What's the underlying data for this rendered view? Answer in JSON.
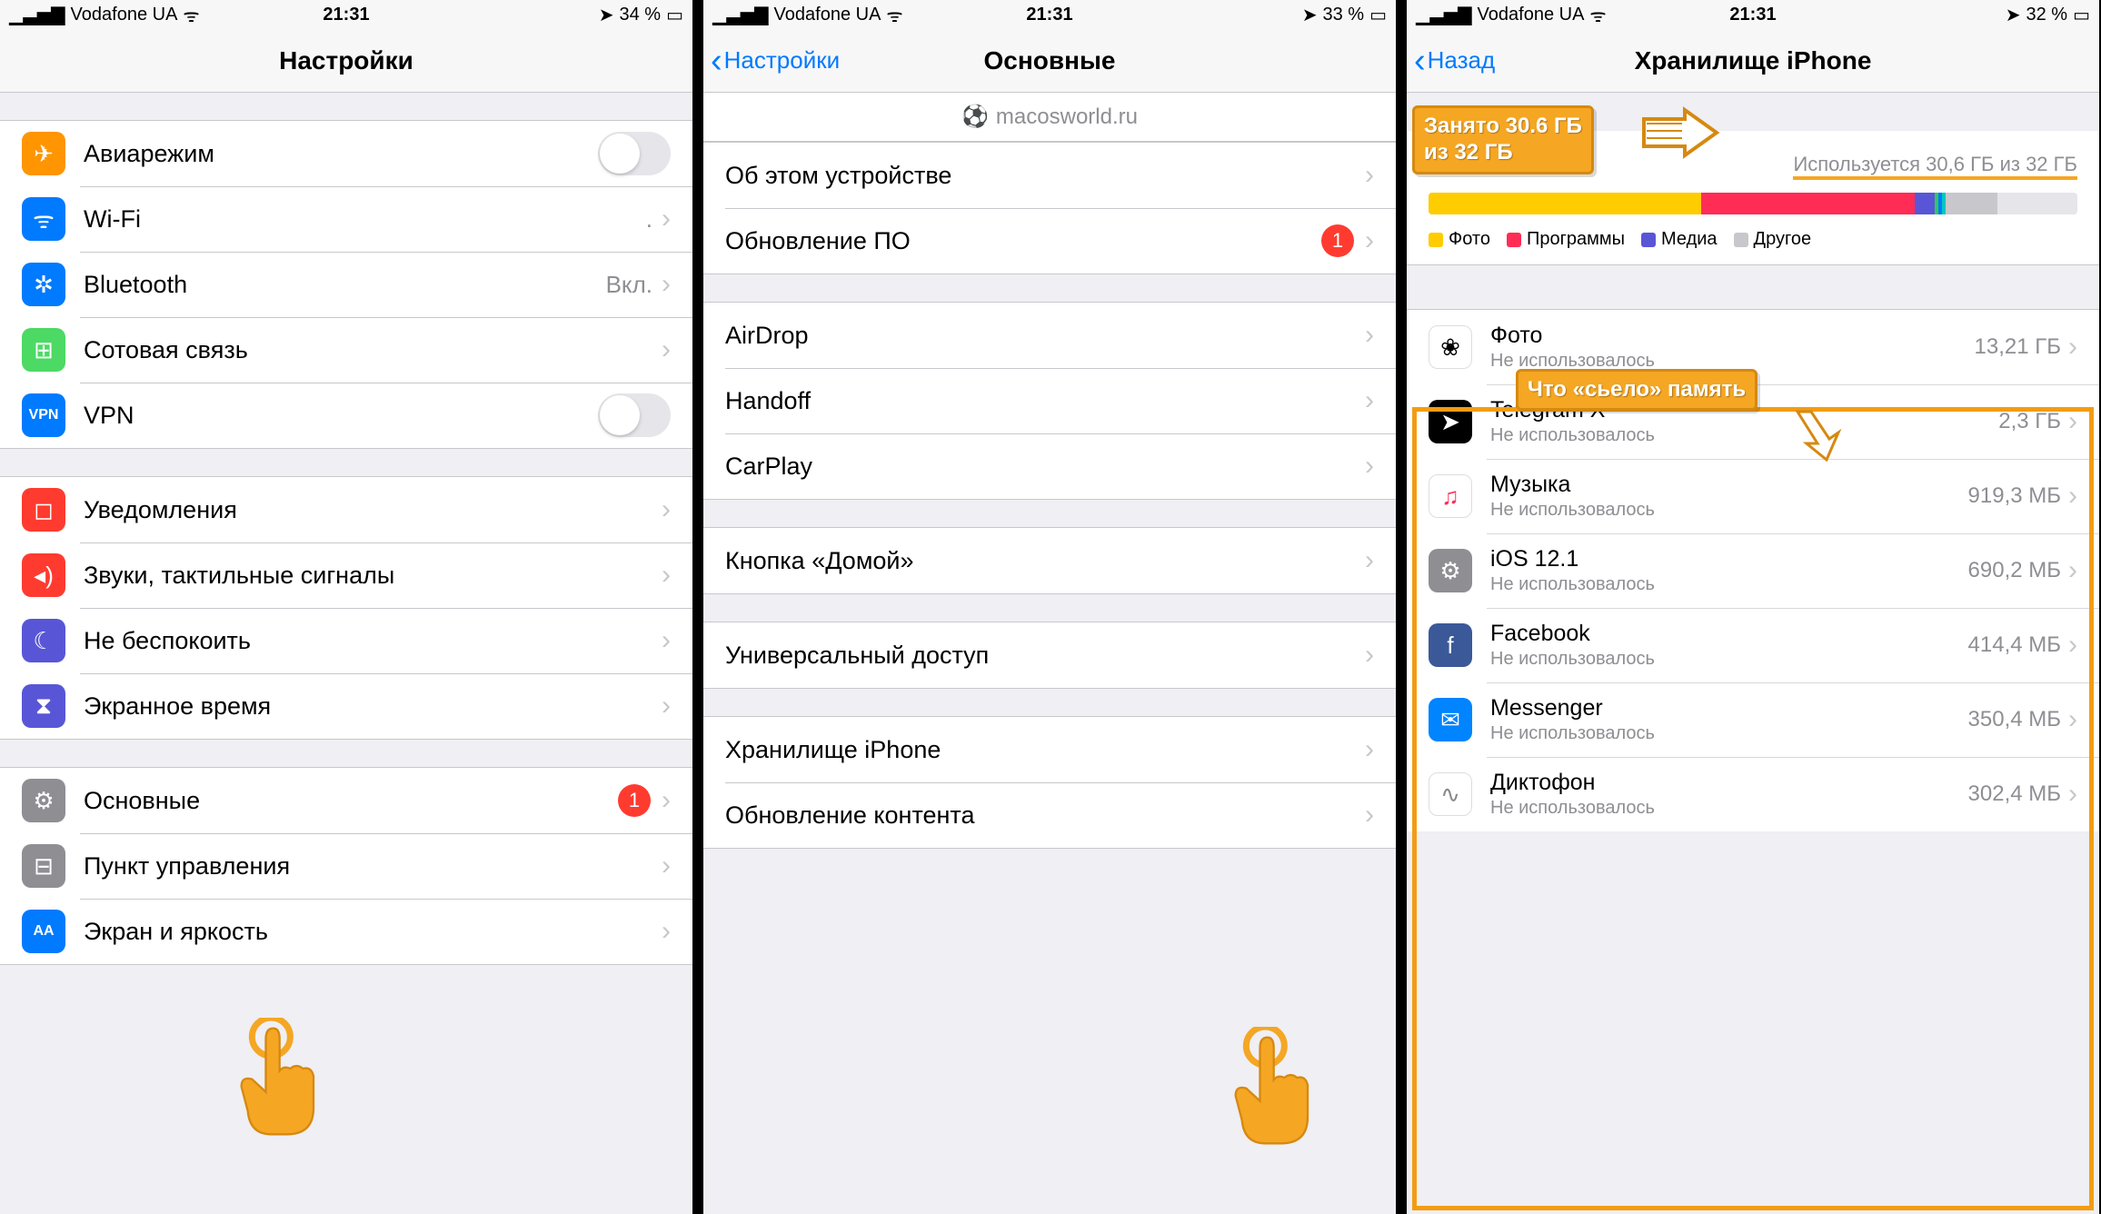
{
  "status_bar": {
    "carrier": "Vodafone UA",
    "time": "21:31",
    "location_icon": "➤",
    "battery1": "34 %",
    "battery2": "33 %",
    "battery3": "32 %"
  },
  "panel1": {
    "title": "Настройки",
    "rows_g1": [
      {
        "icon_bg": "#ff9500",
        "icon": "✈",
        "label": "Авиарежим",
        "type": "toggle"
      },
      {
        "icon_bg": "#007aff",
        "icon": "ᯤ",
        "label": "Wi-Fi",
        "value": ".",
        "type": "link"
      },
      {
        "icon_bg": "#007aff",
        "icon": "✲",
        "label": "Bluetooth",
        "value": "Вкл.",
        "type": "link"
      },
      {
        "icon_bg": "#4cd964",
        "icon": "⊞",
        "label": "Сотовая связь",
        "type": "link"
      },
      {
        "icon_bg": "#007aff",
        "icon_text": "VPN",
        "label": "VPN",
        "type": "toggle"
      }
    ],
    "rows_g2": [
      {
        "icon_bg": "#ff3b30",
        "icon": "◻",
        "label": "Уведомления",
        "type": "link"
      },
      {
        "icon_bg": "#ff3b30",
        "icon": "◂)",
        "label": "Звуки, тактильные сигналы",
        "type": "link"
      },
      {
        "icon_bg": "#5856d6",
        "icon": "☾",
        "label": "Не беспокоить",
        "type": "link"
      },
      {
        "icon_bg": "#5856d6",
        "icon": "⧗",
        "label": "Экранное время",
        "type": "link"
      }
    ],
    "rows_g3": [
      {
        "icon_bg": "#8e8e93",
        "icon": "⚙",
        "label": "Основные",
        "type": "link",
        "badge": "1"
      },
      {
        "icon_bg": "#8e8e93",
        "icon": "⊟",
        "label": "Пункт управления",
        "type": "link"
      },
      {
        "icon_bg": "#007aff",
        "icon_text": "AA",
        "label": "Экран и яркость",
        "type": "link"
      }
    ]
  },
  "panel2": {
    "back": "Настройки",
    "title": "Основные",
    "watermark": "macosworld.ru",
    "rows_g1": [
      {
        "label": "Об этом устройстве"
      },
      {
        "label": "Обновление ПО",
        "badge": "1"
      }
    ],
    "rows_g2": [
      {
        "label": "AirDrop"
      },
      {
        "label": "Handoff"
      },
      {
        "label": "CarPlay"
      }
    ],
    "rows_g3": [
      {
        "label": "Кнопка «Домой»"
      }
    ],
    "rows_g4": [
      {
        "label": "Универсальный доступ"
      }
    ],
    "rows_g5": [
      {
        "label": "Хранилище iPhone"
      },
      {
        "label": "Обновление контента"
      }
    ]
  },
  "panel3": {
    "back": "Назад",
    "title": "Хранилище iPhone",
    "device": "iPhone",
    "used_text": "Используется 30,6 ГБ из 32 ГБ",
    "legend": {
      "photos": "Фото",
      "apps": "Программы",
      "media": "Медиа",
      "other": "Другое"
    },
    "callout_used_l1": "Занято 30.6 ГБ",
    "callout_used_l2": "из 32 ГБ",
    "callout_what": "Что «сьело» память",
    "apps": [
      {
        "name": "Фото",
        "sub": "Не использовалось",
        "size": "13,21 ГБ",
        "bg": "#fff",
        "border": "1px solid #ddd",
        "emoji": "❀"
      },
      {
        "name": "Telegram X",
        "sub": "Не использовалось",
        "size": "2,3 ГБ",
        "bg": "#000",
        "emoji": "➤",
        "color": "#fff"
      },
      {
        "name": "Музыка",
        "sub": "Не использовалось",
        "size": "919,3 МБ",
        "bg": "#fff",
        "border": "1px solid #ddd",
        "emoji": "♫",
        "color": "#ff2d55"
      },
      {
        "name": "iOS 12.1",
        "sub": "Не использовалось",
        "size": "690,2 МБ",
        "bg": "#8e8e93",
        "emoji": "⚙",
        "color": "#fff"
      },
      {
        "name": "Facebook",
        "sub": "Не использовалось",
        "size": "414,4 МБ",
        "bg": "#3b5998",
        "emoji": "f",
        "color": "#fff"
      },
      {
        "name": "Messenger",
        "sub": "Не использовалось",
        "size": "350,4 МБ",
        "bg": "#0084ff",
        "emoji": "✉",
        "color": "#fff"
      },
      {
        "name": "Диктофон",
        "sub": "Не использовалось",
        "size": "302,4 МБ",
        "bg": "#fff",
        "border": "1px solid #ddd",
        "emoji": "∿",
        "color": "#888"
      }
    ]
  }
}
